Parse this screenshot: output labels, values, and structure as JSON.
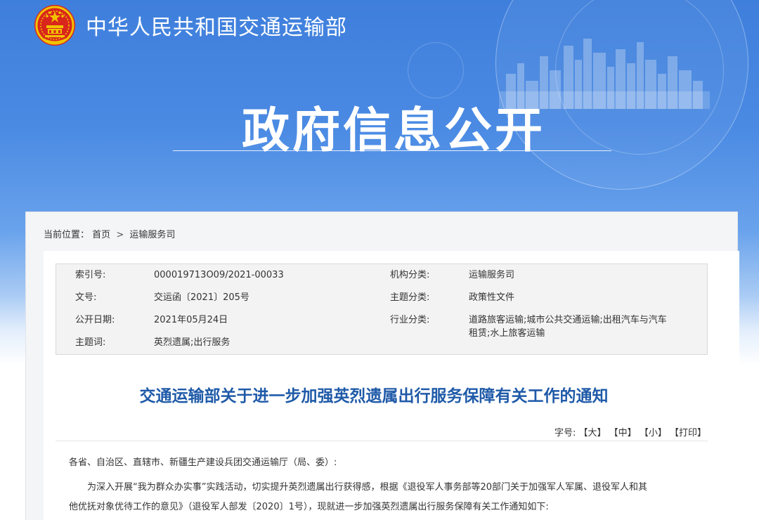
{
  "header": {
    "ministry_name": "中华人民共和国交通运输部",
    "section_title": "政府信息公开"
  },
  "breadcrumb": {
    "prefix": "当前位置：",
    "home": "首页",
    "separator": ">",
    "current": "运输服务司"
  },
  "meta": {
    "index_label": "索引号:",
    "index_value": "000019713O09/2021-00033",
    "org_label": "机构分类:",
    "org_value": "运输服务司",
    "docno_label": "文号:",
    "docno_value": "交运函〔2021〕205号",
    "topic_label": "主题分类:",
    "topic_value": "政策性文件",
    "date_label": "公开日期:",
    "date_value": "2021年05月24日",
    "industry_label": "行业分类:",
    "industry_value_line1": "道路旅客运输;城市公共交通运输;出租汽车与汽车",
    "industry_value_line2": "租赁;水上旅客运输",
    "keyword_label": "主题词:",
    "keyword_value": "英烈遗属;出行服务"
  },
  "document": {
    "title": "交通运输部关于进一步加强英烈遗属出行服务保障有关工作的通知",
    "fontsize_label": "字号:",
    "fontsize_large": "【大】",
    "fontsize_medium": "【中】",
    "fontsize_small": "【小】",
    "print": "【打印】",
    "salutation": "各省、自治区、直辖市、新疆生产建设兵团交通运输厅（局、委）:",
    "body_line1": "为深入开展“我为群众办实事”实践活动，切实提升英烈遗属出行获得感，根据《退役军人事务部等20部门关于加强军人军属、退役军人和其",
    "body_line2": "他优抚对象优待工作的意见》（退役军人部发〔2020〕1号），现就进一步加强英烈遗属出行服务保障有关工作通知如下:"
  },
  "colors": {
    "banner_blue": "#3f7fdc",
    "title_blue": "#1f5aa8",
    "emblem_red": "#d9261c",
    "emblem_gold": "#f2c200"
  }
}
